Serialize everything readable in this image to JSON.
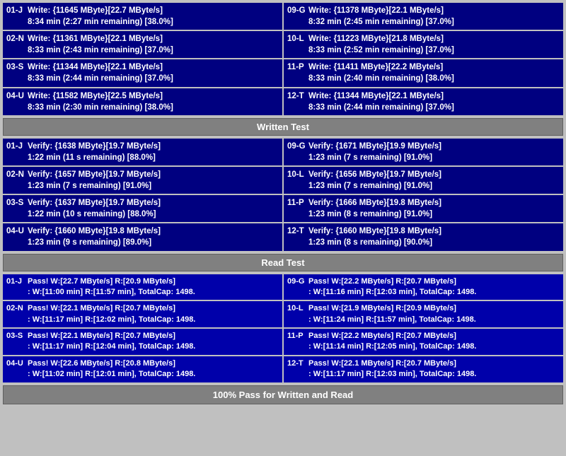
{
  "sections": {
    "write": {
      "label": "Written Test",
      "rows_left": [
        {
          "id": "01-J",
          "line1": "Write: {11645 MByte}[22.7 MByte/s]",
          "line2": "8:34 min (2:27 min remaining)  [38.0%]"
        },
        {
          "id": "02-N",
          "line1": "Write: {11361 MByte}[22.1 MByte/s]",
          "line2": "8:33 min (2:43 min remaining)  [37.0%]"
        },
        {
          "id": "03-S",
          "line1": "Write: {11344 MByte}[22.1 MByte/s]",
          "line2": "8:33 min (2:44 min remaining)  [37.0%]"
        },
        {
          "id": "04-U",
          "line1": "Write: {11582 MByte}[22.5 MByte/s]",
          "line2": "8:33 min (2:30 min remaining)  [38.0%]"
        }
      ],
      "rows_right": [
        {
          "id": "09-G",
          "line1": "Write: {11378 MByte}[22.1 MByte/s]",
          "line2": "8:32 min (2:45 min remaining)  [37.0%]"
        },
        {
          "id": "10-L",
          "line1": "Write: {11223 MByte}[21.8 MByte/s]",
          "line2": "8:33 min (2:52 min remaining)  [37.0%]"
        },
        {
          "id": "11-P",
          "line1": "Write: {11411 MByte}[22.2 MByte/s]",
          "line2": "8:33 min (2:40 min remaining)  [38.0%]"
        },
        {
          "id": "12-T",
          "line1": "Write: {11344 MByte}[22.1 MByte/s]",
          "line2": "8:33 min (2:44 min remaining)  [37.0%]"
        }
      ]
    },
    "verify": {
      "label": "Written Test",
      "rows_left": [
        {
          "id": "01-J",
          "line1": "Verify: {1638 MByte}[19.7 MByte/s]",
          "line2": "1:22 min (11 s remaining)   [88.0%]"
        },
        {
          "id": "02-N",
          "line1": "Verify: {1657 MByte}[19.7 MByte/s]",
          "line2": "1:23 min (7 s remaining)   [91.0%]"
        },
        {
          "id": "03-S",
          "line1": "Verify: {1637 MByte}[19.7 MByte/s]",
          "line2": "1:22 min (10 s remaining)   [88.0%]"
        },
        {
          "id": "04-U",
          "line1": "Verify: {1660 MByte}[19.8 MByte/s]",
          "line2": "1:23 min (9 s remaining)   [89.0%]"
        }
      ],
      "rows_right": [
        {
          "id": "09-G",
          "line1": "Verify: {1671 MByte}[19.9 MByte/s]",
          "line2": "1:23 min (7 s remaining)   [91.0%]"
        },
        {
          "id": "10-L",
          "line1": "Verify: {1656 MByte}[19.7 MByte/s]",
          "line2": "1:23 min (7 s remaining)   [91.0%]"
        },
        {
          "id": "11-P",
          "line1": "Verify: {1666 MByte}[19.8 MByte/s]",
          "line2": "1:23 min (8 s remaining)   [91.0%]"
        },
        {
          "id": "12-T",
          "line1": "Verify: {1660 MByte}[19.8 MByte/s]",
          "line2": "1:23 min (8 s remaining)   [90.0%]"
        }
      ]
    },
    "read": {
      "label": "Read Test",
      "rows_left": [
        {
          "id": "01-J",
          "line1": "Pass! W:[22.7 MByte/s] R:[20.9 MByte/s]",
          "line2": ": W:[11:00 min] R:[11:57 min], TotalCap: 1498."
        },
        {
          "id": "02-N",
          "line1": "Pass! W:[22.1 MByte/s] R:[20.7 MByte/s]",
          "line2": ": W:[11:17 min] R:[12:02 min], TotalCap: 1498."
        },
        {
          "id": "03-S",
          "line1": "Pass! W:[22.1 MByte/s] R:[20.7 MByte/s]",
          "line2": ": W:[11:17 min] R:[12:04 min], TotalCap: 1498."
        },
        {
          "id": "04-U",
          "line1": "Pass! W:[22.6 MByte/s] R:[20.8 MByte/s]",
          "line2": ": W:[11:02 min] R:[12:01 min], TotalCap: 1498."
        }
      ],
      "rows_right": [
        {
          "id": "09-G",
          "line1": "Pass! W:[22.2 MByte/s] R:[20.7 MByte/s]",
          "line2": ": W:[11:16 min] R:[12:03 min], TotalCap: 1498."
        },
        {
          "id": "10-L",
          "line1": "Pass! W:[21.9 MByte/s] R:[20.9 MByte/s]",
          "line2": ": W:[11:24 min] R:[11:57 min], TotalCap: 1498."
        },
        {
          "id": "11-P",
          "line1": "Pass! W:[22.2 MByte/s] R:[20.7 MByte/s]",
          "line2": ": W:[11:14 min] R:[12:05 min], TotalCap: 1498."
        },
        {
          "id": "12-T",
          "line1": "Pass! W:[22.1 MByte/s] R:[20.7 MByte/s]",
          "line2": ": W:[11:17 min] R:[12:03 min], TotalCap: 1498."
        }
      ]
    }
  },
  "footer_label": "100% Pass for Written and Read"
}
